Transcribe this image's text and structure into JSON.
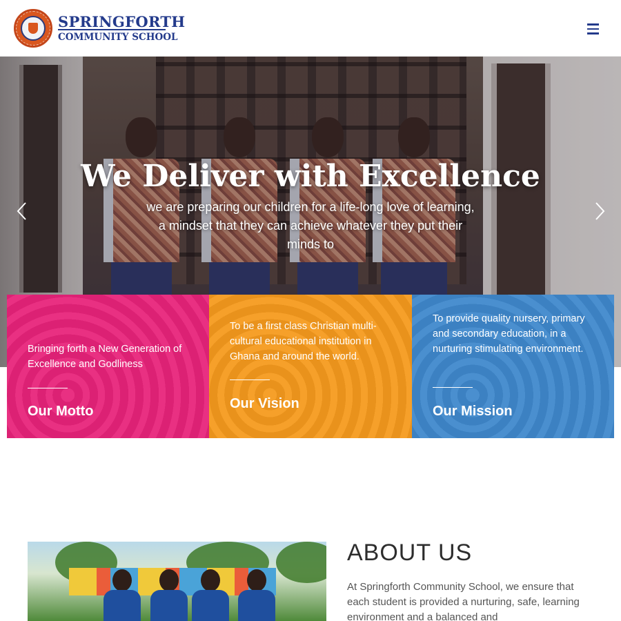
{
  "header": {
    "brand_name": "SPRINGFORTH",
    "brand_sub": "COMMUNITY SCHOOL",
    "menu_icon": "hamburger-menu-icon"
  },
  "hero": {
    "title": "We Deliver with Excellence",
    "subtitle": "we are preparing our children for a life-long love of learning, a mindset that they can achieve whatever they put their minds to",
    "prev_icon": "chevron-left-icon",
    "next_icon": "chevron-right-icon"
  },
  "boxes": [
    {
      "text": "Bringing forth a New Generation of Excellence and Godliness",
      "title": "Our Motto",
      "color": "#e8237a"
    },
    {
      "text": "To be a first class Christian multi-cultural educational institution in Ghana and around the world.",
      "title": "Our Vision",
      "color": "#f59a1d"
    },
    {
      "text": "To provide quality nursery, primary and secondary education, in a nurturing stimulating environment.",
      "title": "Our Mission",
      "color": "#3f88cc"
    }
  ],
  "about": {
    "title": "ABOUT US",
    "text": "At Springforth Community School, we ensure that each student is provided a nurturing, safe, learning environment and a balanced and"
  },
  "colors": {
    "brand_blue": "#233a8b",
    "motto_pink": "#e8237a",
    "vision_orange": "#f59a1d",
    "mission_blue": "#3f88cc"
  }
}
